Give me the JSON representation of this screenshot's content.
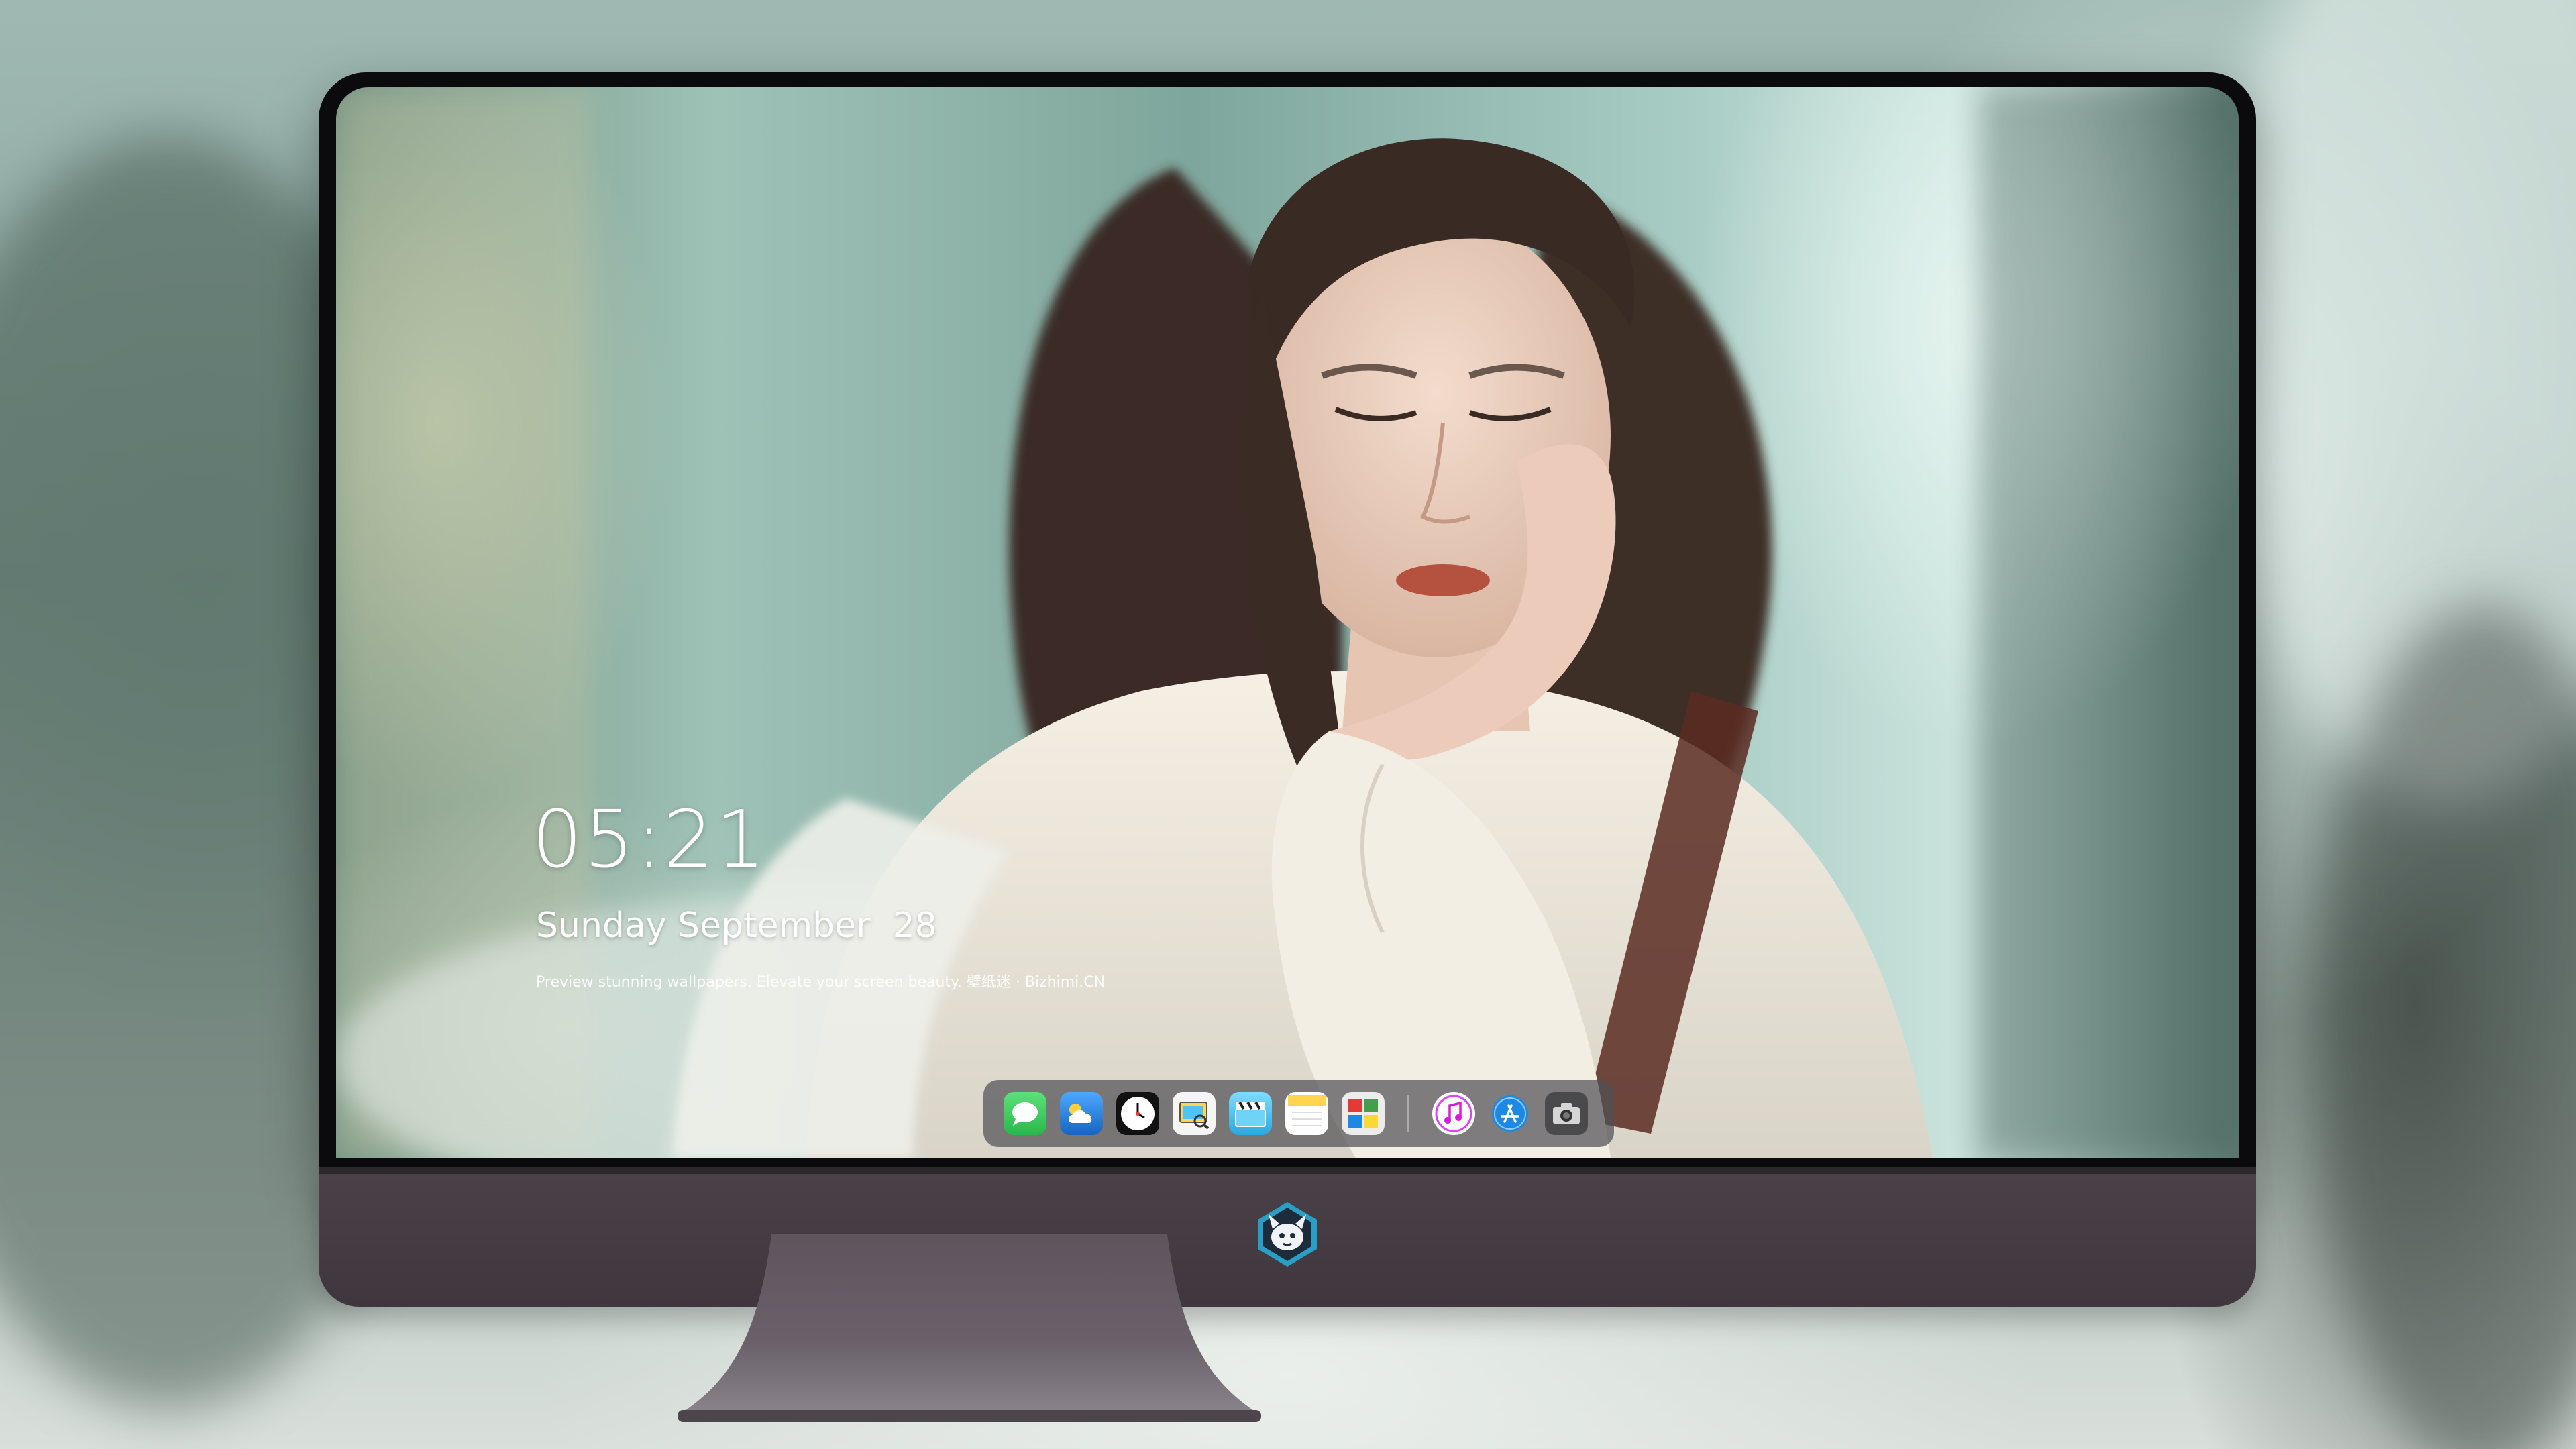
{
  "lockscreen": {
    "time": "05:21",
    "date": "Sunday September  28",
    "tagline_main": "Preview stunning wallpapers. Elevate your screen beauty. 壁纸迷 · Bizhimi.CN",
    "tagline_dim": ""
  },
  "dock": {
    "apps": [
      {
        "name": "messages",
        "icon": "message-bubble-icon",
        "color": "#34c759"
      },
      {
        "name": "weather",
        "icon": "cloud-icon",
        "color": "#1e88e5"
      },
      {
        "name": "clock",
        "icon": "clock-icon",
        "color": "#111111"
      },
      {
        "name": "preview",
        "icon": "photo-viewer-icon",
        "color": "#f2f2f2"
      },
      {
        "name": "video",
        "icon": "clapperboard-icon",
        "color": "#5ac8fa"
      },
      {
        "name": "notes",
        "icon": "notes-icon",
        "color": "#ffd54f"
      },
      {
        "name": "photo-booth",
        "icon": "photo-grid-icon",
        "color": "#e8e8e8"
      },
      {
        "name": "music",
        "icon": "music-note-icon",
        "color": "#e040fb"
      },
      {
        "name": "app-store",
        "icon": "app-store-icon",
        "color": "#1e88e5"
      },
      {
        "name": "camera",
        "icon": "camera-icon",
        "color": "#555555"
      }
    ]
  },
  "monitor": {
    "chin_logo": "fox-mascot-logo",
    "bezel_color": "#0b0b0d",
    "chin_color": "#433a42"
  }
}
